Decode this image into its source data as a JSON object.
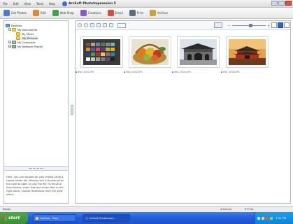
{
  "menu": [
    "File",
    "Edit",
    "View",
    "Tools",
    "Help"
  ],
  "app_title": "ArcSoft PhotoImpression 5",
  "toolbar": [
    {
      "label": "Get Photos",
      "icon": "camera-icon",
      "color": "#4a7bd1"
    },
    {
      "label": "Edit",
      "icon": "edit-icon",
      "color": "#e08a2c"
    },
    {
      "label": "Web Shop",
      "icon": "web-shop-icon",
      "color": "#3fa34b"
    },
    {
      "label": "Creations",
      "icon": "creations-icon",
      "color": "#8a5bc8"
    },
    {
      "label": "Email",
      "icon": "email-icon",
      "color": "#d24f3c"
    },
    {
      "label": "Print",
      "icon": "printer-icon",
      "color": "#5b6b84"
    },
    {
      "label": "Archive",
      "icon": "archive-icon",
      "color": "#c9a23a"
    }
  ],
  "tree": [
    {
      "label": "Desktop",
      "type": "desk"
    },
    {
      "label": "My Documents",
      "type": "folder",
      "expanded": true
    },
    {
      "label": "My Music",
      "type": "folder"
    },
    {
      "label": "My Pictures",
      "type": "folder",
      "selected": true
    },
    {
      "label": "My Computer",
      "type": "comp"
    },
    {
      "label": "My Network Places",
      "type": "net"
    }
  ],
  "info_text": "Here, you can explore for your media using a classic folder list. Double click a thumbnail on the right to open or play the file. To move or hide folders, video files and music files in the right panel, choose Hide/show from the View menu.",
  "thumbnails": [
    {
      "name": "IMG_0001.JPG",
      "kind": "color-chart"
    },
    {
      "name": "IMG_0002.JPG",
      "kind": "fruit-basket"
    },
    {
      "name": "IMG_0003.JPG",
      "kind": "gate"
    },
    {
      "name": "IMG_0004.JPG",
      "kind": "pagoda"
    }
  ],
  "status": {
    "left": "Ready",
    "mid": "4 item(s)",
    "right": "977 kb"
  },
  "taskbar": {
    "start": "start",
    "tasks": [
      "Untitled - Paint",
      "ArcSoft PhotoImpre..."
    ],
    "clock": "1:04 PM"
  },
  "colors": {
    "taskbar": "#245edb",
    "start": "#3b8f35",
    "selection": "#2c66c6"
  }
}
